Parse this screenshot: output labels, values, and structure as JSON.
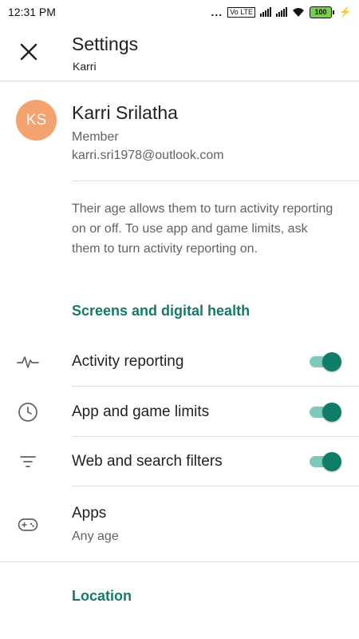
{
  "status_bar": {
    "time": "12:31 PM",
    "dots": "...",
    "volte": "Vo LTE",
    "battery": "100"
  },
  "app_bar": {
    "title": "Settings",
    "subtitle": "Karri"
  },
  "profile": {
    "initials": "KS",
    "name": "Karri Srilatha",
    "role": "Member",
    "email": "karri.sri1978@outlook.com",
    "avatar_color": "#f4a26e"
  },
  "info_text": "Their age allows them to turn activity reporting on or off. To use app and game limits, ask them to turn activity reporting on.",
  "sections": {
    "screens_header": "Screens and digital health",
    "location_header": "Location"
  },
  "settings": [
    {
      "label": "Activity reporting",
      "icon": "activity-pulse-icon",
      "toggle_on": true
    },
    {
      "label": "App and game limits",
      "icon": "clock-icon",
      "toggle_on": true
    },
    {
      "label": "Web and search filters",
      "icon": "filter-icon",
      "toggle_on": true
    }
  ],
  "apps": {
    "label": "Apps",
    "sublabel": "Any age",
    "icon": "gamepad-icon"
  },
  "colors": {
    "accent": "#137a6a",
    "toggle_thumb": "#0f7d68",
    "toggle_track": "#7fc8bc"
  }
}
